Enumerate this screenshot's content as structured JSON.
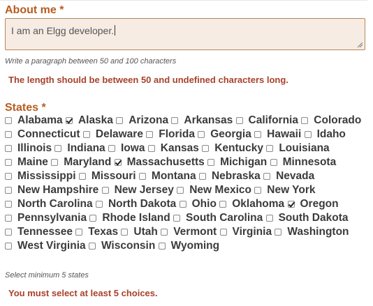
{
  "about": {
    "label": "About me",
    "required_mark": "*",
    "value": "I am an Elgg developer.",
    "hint": "Write a paragraph between 50 and 100 characters",
    "error": "The length should be between 50 and undefined characters long."
  },
  "states": {
    "label": "States",
    "required_mark": "*",
    "hint": "Select minimum 5 states",
    "error": "You must select at least 5 choices.",
    "options": [
      {
        "label": "Alabama",
        "checked": false
      },
      {
        "label": "Alaska",
        "checked": true
      },
      {
        "label": "Arizona",
        "checked": false
      },
      {
        "label": "Arkansas",
        "checked": false
      },
      {
        "label": "California",
        "checked": false
      },
      {
        "label": "Colorado",
        "checked": false
      },
      {
        "label": "Connecticut",
        "checked": false
      },
      {
        "label": "Delaware",
        "checked": false
      },
      {
        "label": "Florida",
        "checked": false
      },
      {
        "label": "Georgia",
        "checked": false
      },
      {
        "label": "Hawaii",
        "checked": false
      },
      {
        "label": "Idaho",
        "checked": false
      },
      {
        "label": "Illinois",
        "checked": false
      },
      {
        "label": "Indiana",
        "checked": false
      },
      {
        "label": "Iowa",
        "checked": false
      },
      {
        "label": "Kansas",
        "checked": false
      },
      {
        "label": "Kentucky",
        "checked": false
      },
      {
        "label": "Louisiana",
        "checked": false
      },
      {
        "label": "Maine",
        "checked": false
      },
      {
        "label": "Maryland",
        "checked": false
      },
      {
        "label": "Massachusetts",
        "checked": true
      },
      {
        "label": "Michigan",
        "checked": false
      },
      {
        "label": "Minnesota",
        "checked": false
      },
      {
        "label": "Mississippi",
        "checked": false
      },
      {
        "label": "Missouri",
        "checked": false
      },
      {
        "label": "Montana",
        "checked": false
      },
      {
        "label": "Nebraska",
        "checked": false
      },
      {
        "label": "Nevada",
        "checked": false
      },
      {
        "label": "New Hampshire",
        "checked": false
      },
      {
        "label": "New Jersey",
        "checked": false
      },
      {
        "label": "New Mexico",
        "checked": false
      },
      {
        "label": "New York",
        "checked": false
      },
      {
        "label": "North Carolina",
        "checked": false
      },
      {
        "label": "North Dakota",
        "checked": false
      },
      {
        "label": "Ohio",
        "checked": false
      },
      {
        "label": "Oklahoma",
        "checked": false
      },
      {
        "label": "Oregon",
        "checked": true
      },
      {
        "label": "Pennsylvania",
        "checked": false
      },
      {
        "label": "Rhode Island",
        "checked": false
      },
      {
        "label": "South Carolina",
        "checked": false
      },
      {
        "label": "South Dakota",
        "checked": false
      },
      {
        "label": "Tennessee",
        "checked": false
      },
      {
        "label": "Texas",
        "checked": false
      },
      {
        "label": "Utah",
        "checked": false
      },
      {
        "label": "Vermont",
        "checked": false
      },
      {
        "label": "Virginia",
        "checked": false
      },
      {
        "label": "Washington",
        "checked": false
      },
      {
        "label": "West Virginia",
        "checked": false
      },
      {
        "label": "Wisconsin",
        "checked": false
      },
      {
        "label": "Wyoming",
        "checked": false
      }
    ]
  }
}
